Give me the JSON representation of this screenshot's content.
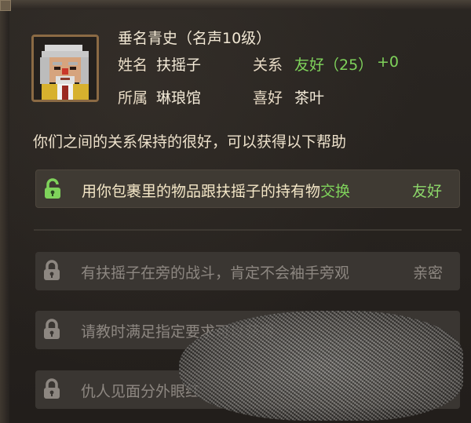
{
  "npc": {
    "title": "垂名青史（名声10级）",
    "name_label": "姓名",
    "name": "扶摇子",
    "relation_label": "关系",
    "relation": "友好（25）",
    "relation_delta": "+0",
    "faction_label": "所属",
    "faction": "琳琅馆",
    "likes_label": "喜好",
    "likes": "茶叶"
  },
  "help_text": "你们之间的关系保持的很好，可以获得以下帮助",
  "benefits": [
    {
      "text_main": "用你包裹里的物品跟扶摇子的持有物",
      "text_action": "交换",
      "tier": "友好",
      "unlocked": true
    },
    {
      "text_main": "有扶摇子在旁的战斗，肯定不会袖手旁观",
      "text_action": "",
      "tier": "亲密",
      "unlocked": false
    },
    {
      "text_main": "请教时满足指定要求可以获得",
      "text_action": "",
      "tier": "",
      "unlocked": false
    },
    {
      "text_main": "仇人见面分外眼红",
      "text_action": "",
      "tier": "",
      "unlocked": false
    }
  ],
  "colors": {
    "accent_green": "#7fd35b",
    "locked_text": "#8d8781"
  },
  "icons": {
    "unlocked": "unlocked-padlock-icon",
    "locked": "locked-padlock-icon"
  }
}
